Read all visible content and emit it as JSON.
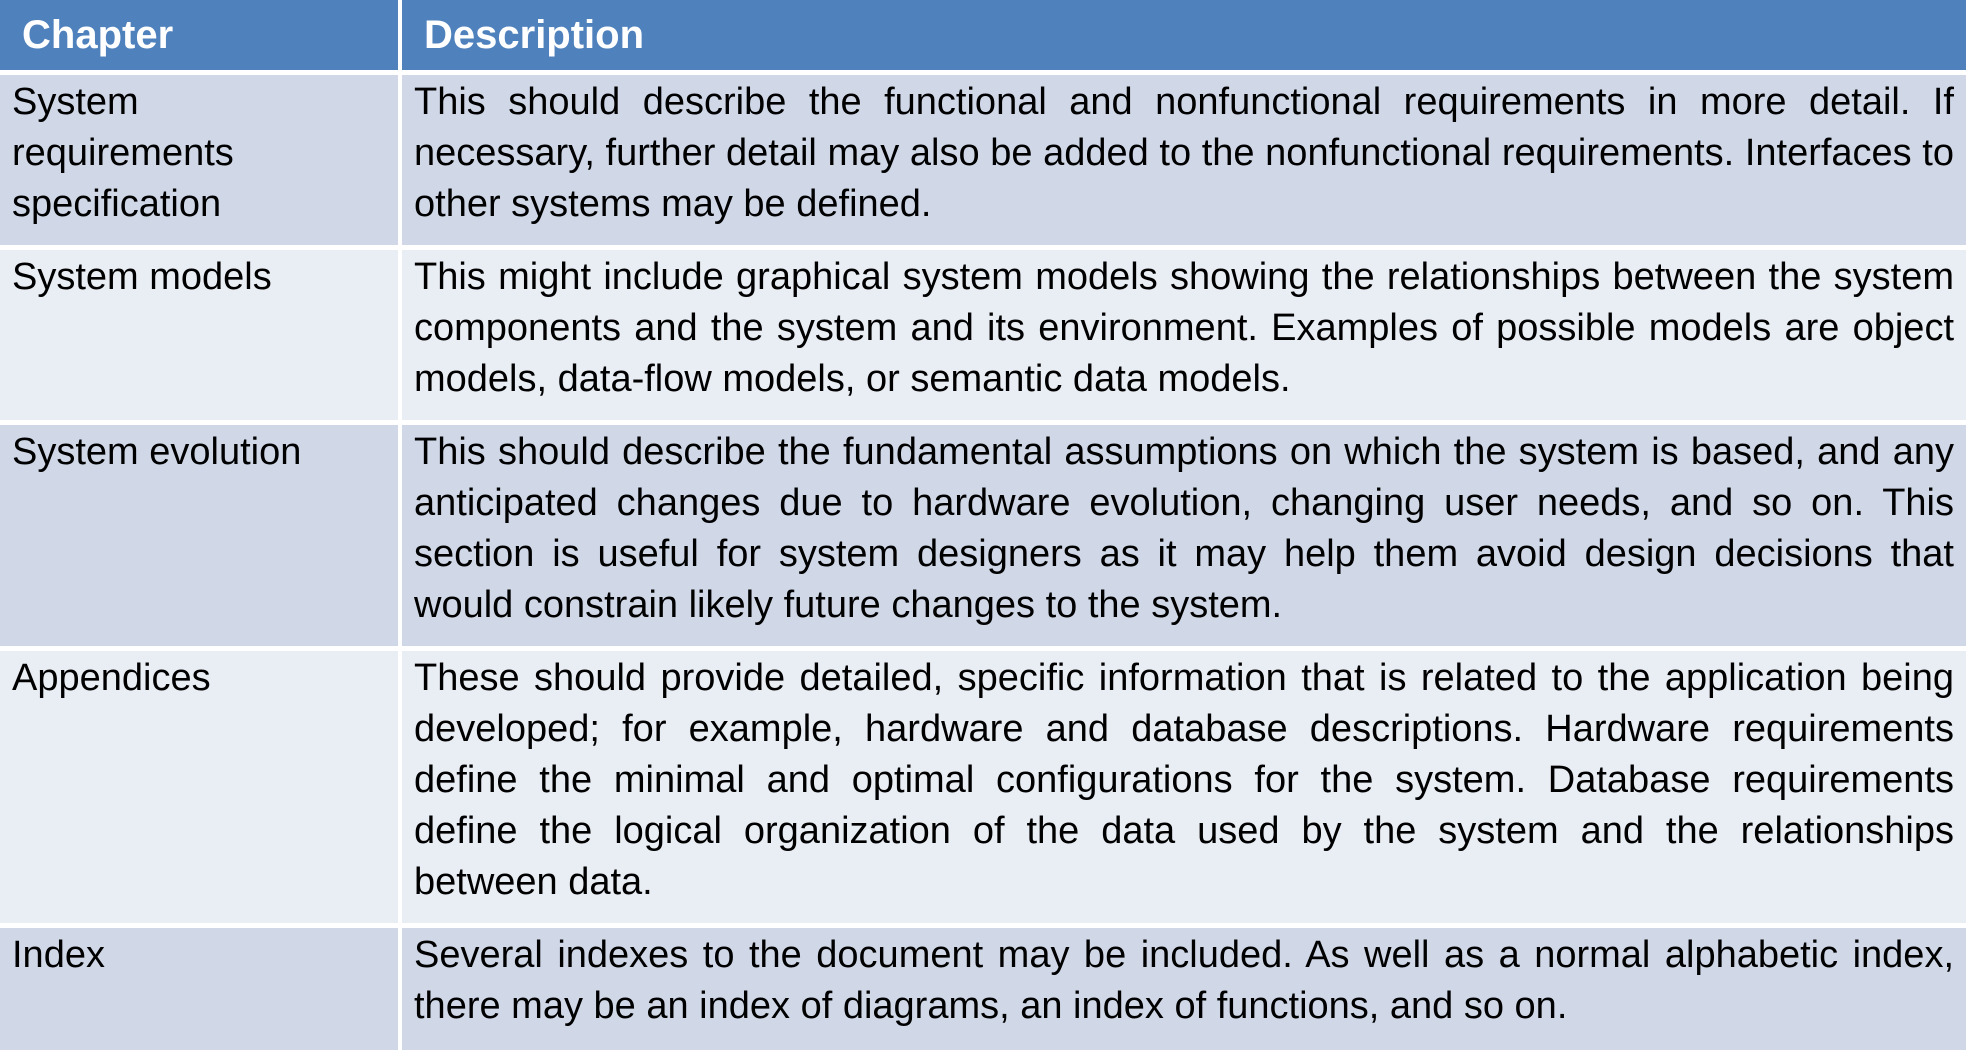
{
  "table": {
    "headers": {
      "chapter": "Chapter",
      "description": "Description"
    },
    "rows": [
      {
        "chapter": "System requirements specification",
        "chapter_lines": [
          "System",
          "requirements",
          "specification"
        ],
        "description": "This should describe the functional and nonfunctional requirements in more detail. If necessary, further detail may also be added to the nonfunctional requirements. Interfaces to other systems may be defined."
      },
      {
        "chapter": "System models",
        "chapter_lines": [
          "System models"
        ],
        "description": "This might include graphical system models showing the relationships between the system components and the system and its environment. Examples of possible models are object models, data-flow models, or semantic data models."
      },
      {
        "chapter": "System evolution",
        "chapter_lines": [
          "System evolution"
        ],
        "description": "This should describe the fundamental assumptions on which the system is based, and any anticipated changes due to hardware evolution, changing user needs, and so on. This section is useful for system designers as it may help them avoid design decisions that would constrain likely future changes to the system."
      },
      {
        "chapter": "Appendices",
        "chapter_lines": [
          "Appendices"
        ],
        "description": "These should provide detailed, specific information that is related to the application being developed; for example, hardware and database descriptions. Hardware requirements define the minimal and optimal configurations for the system. Database requirements define the logical organization of the data used by the system and the relationships between data."
      },
      {
        "chapter": "Index",
        "chapter_lines": [
          "Index"
        ],
        "description": "Several indexes to the document may be included. As well as a normal alphabetic index, there may be an index of diagrams, an index of functions, and so on."
      }
    ]
  },
  "colors": {
    "header_bg": "#4f81bd",
    "row_dark": "#d0d8e8",
    "row_light": "#e9edf4"
  }
}
